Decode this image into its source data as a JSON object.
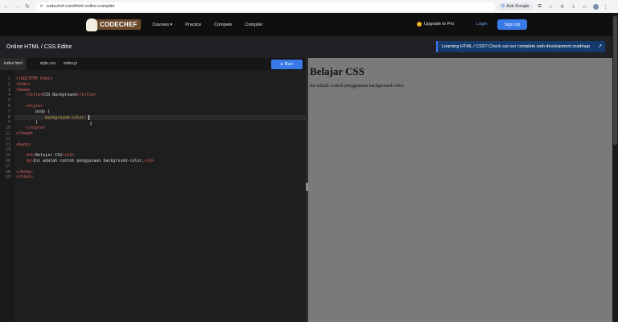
{
  "browser": {
    "url": "codechef.com/html-online-compiler",
    "ask_google": "Ask Google"
  },
  "header": {
    "logo": "CODECHEF",
    "nav": [
      "Courses ▾",
      "Practice",
      "Compete",
      "Compiler"
    ],
    "upgrade": "Upgrade to Pro",
    "login": "Login",
    "signup": "Sign Up"
  },
  "titlebar": {
    "title": "Online HTML / CSS Editor",
    "banner": "Learning HTML / CSS? Check out our complete web development roadmap",
    "banner_arrow": "↗"
  },
  "editor": {
    "tabs": [
      "index.html",
      "style.css",
      "index.js"
    ],
    "run_label": "▸  Run",
    "lines": [
      "<!DOCTYPE html>",
      "<html>",
      "<head>",
      "    <title>CSS Background</title>",
      "",
      "    <style>",
      "        body {",
      "            background-color: ",
      "        }",
      "    </style>",
      "</head>",
      "",
      "<body>",
      "",
      "    <h1>Belajar CSS</h1>",
      "    <p>Ini adalah contoh penggunaan background-color.</p>",
      "",
      "</body>",
      "</html>"
    ]
  },
  "preview": {
    "heading": "Belajar CSS",
    "paragraph": "Ini adalah contoh penggunaan background-color."
  }
}
